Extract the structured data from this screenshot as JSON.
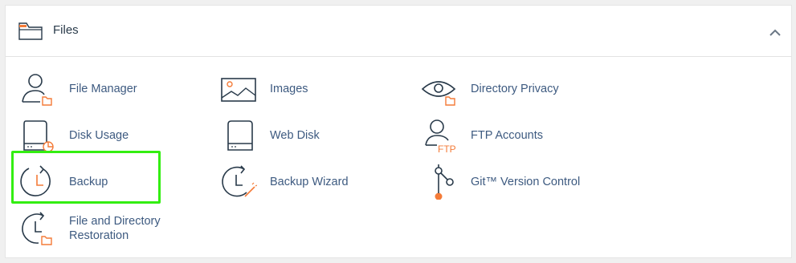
{
  "section": {
    "title": "Files",
    "collapse_icon": "chevron-up-icon"
  },
  "colors": {
    "link": "#3d5a80",
    "accent": "#f47b38",
    "icon_stroke": "#293a4a",
    "highlight": "#33ee11"
  },
  "tools": [
    {
      "label": "File Manager",
      "icon": "file-manager-icon"
    },
    {
      "label": "Images",
      "icon": "images-icon"
    },
    {
      "label": "Directory Privacy",
      "icon": "directory-privacy-icon"
    },
    {
      "label": "Disk Usage",
      "icon": "disk-usage-icon"
    },
    {
      "label": "Web Disk",
      "icon": "web-disk-icon"
    },
    {
      "label": "FTP Accounts",
      "icon": "ftp-accounts-icon"
    },
    {
      "label": "Backup",
      "icon": "backup-icon",
      "highlighted": true
    },
    {
      "label": "Backup Wizard",
      "icon": "backup-wizard-icon"
    },
    {
      "label": "Git™ Version Control",
      "icon": "git-icon"
    },
    {
      "label": "File and Directory Restoration",
      "icon": "restoration-icon"
    }
  ],
  "ftp_icon_text": "FTP"
}
